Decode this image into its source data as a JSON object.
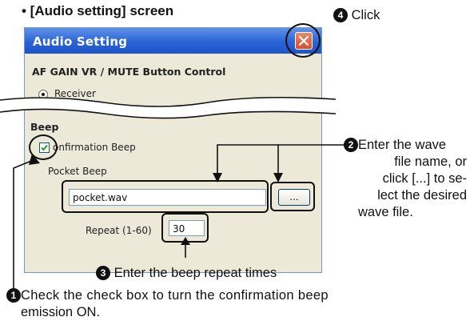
{
  "section_title": "• [Audio setting] screen",
  "dialog": {
    "title": "Audio Setting",
    "group_af": "AF GAIN VR / MUTE Button Control",
    "receiver_label": "Receiver",
    "group_beep": "Beep",
    "confirmation_label": "onfirmation Beep",
    "confirmation_checked": true,
    "pocket_beep_label": "Pocket Beep",
    "wave_file_value": "pocket.wav",
    "browse_label": "...",
    "repeat_label": "Repeat (1-60)",
    "repeat_value": "30"
  },
  "callouts": {
    "step1_num": "1",
    "step1_text": "Check the check box to turn the confirmation beep",
    "step1_text2": "emission ON.",
    "step2_num": "2",
    "step2_line1": "Enter the wave",
    "step2_line2": "file name, or",
    "step2_line3": "click [...] to se-",
    "step2_line4": "lect the desired",
    "step2_line5": "wave file.",
    "step3_num": "3",
    "step3_text": "Enter the beep repeat times",
    "step4_num": "4",
    "step4_text": "Click"
  },
  "colors": {
    "titlebar": "#2a63d6",
    "dialog_bg": "#ece9d8",
    "close_button": "#d4502c"
  }
}
